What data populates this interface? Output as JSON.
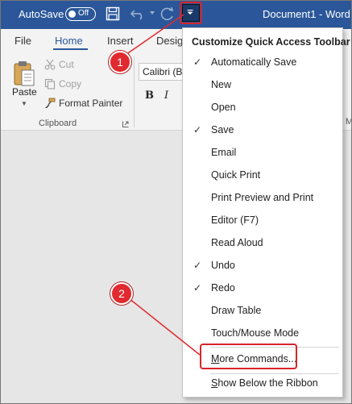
{
  "titlebar": {
    "autosave_label": "AutoSave",
    "autosave_state": "Off",
    "document_title": "Document1  -  Word"
  },
  "tabs": [
    {
      "label": "File"
    },
    {
      "label": "Home",
      "active": true
    },
    {
      "label": "Insert"
    },
    {
      "label": "Desig"
    }
  ],
  "ribbon": {
    "paste_label": "Paste",
    "cut_label": "Cut",
    "copy_label": "Copy",
    "format_painter_label": "Format Painter",
    "clipboard_group_label": "Clipboard",
    "font_name": "Calibri (B",
    "bold": "B",
    "italic": "I",
    "right_group_fragment": "Ma"
  },
  "menu": {
    "title": "Customize Quick Access Toolbar",
    "items": [
      {
        "label": "Automatically Save",
        "checked": true
      },
      {
        "label": "New",
        "checked": false
      },
      {
        "label": "Open",
        "checked": false
      },
      {
        "label": "Save",
        "checked": true
      },
      {
        "label": "Email",
        "checked": false
      },
      {
        "label": "Quick Print",
        "checked": false
      },
      {
        "label": "Print Preview and Print",
        "checked": false
      },
      {
        "label": "Editor (F7)",
        "checked": false
      },
      {
        "label": "Read Aloud",
        "checked": false
      },
      {
        "label": "Undo",
        "checked": true
      },
      {
        "label": "Redo",
        "checked": true
      },
      {
        "label": "Draw Table",
        "checked": false
      },
      {
        "label": "Touch/Mouse Mode",
        "checked": false
      },
      {
        "label": "More Commands...",
        "checked": false
      },
      {
        "label": "Show Below the Ribbon",
        "checked": false
      }
    ],
    "check_glyph": "✓"
  },
  "annotations": {
    "step1": "1",
    "step2": "2"
  },
  "colors": {
    "title_bar": "#2b579a",
    "annotation_red": "#e02a2f"
  }
}
